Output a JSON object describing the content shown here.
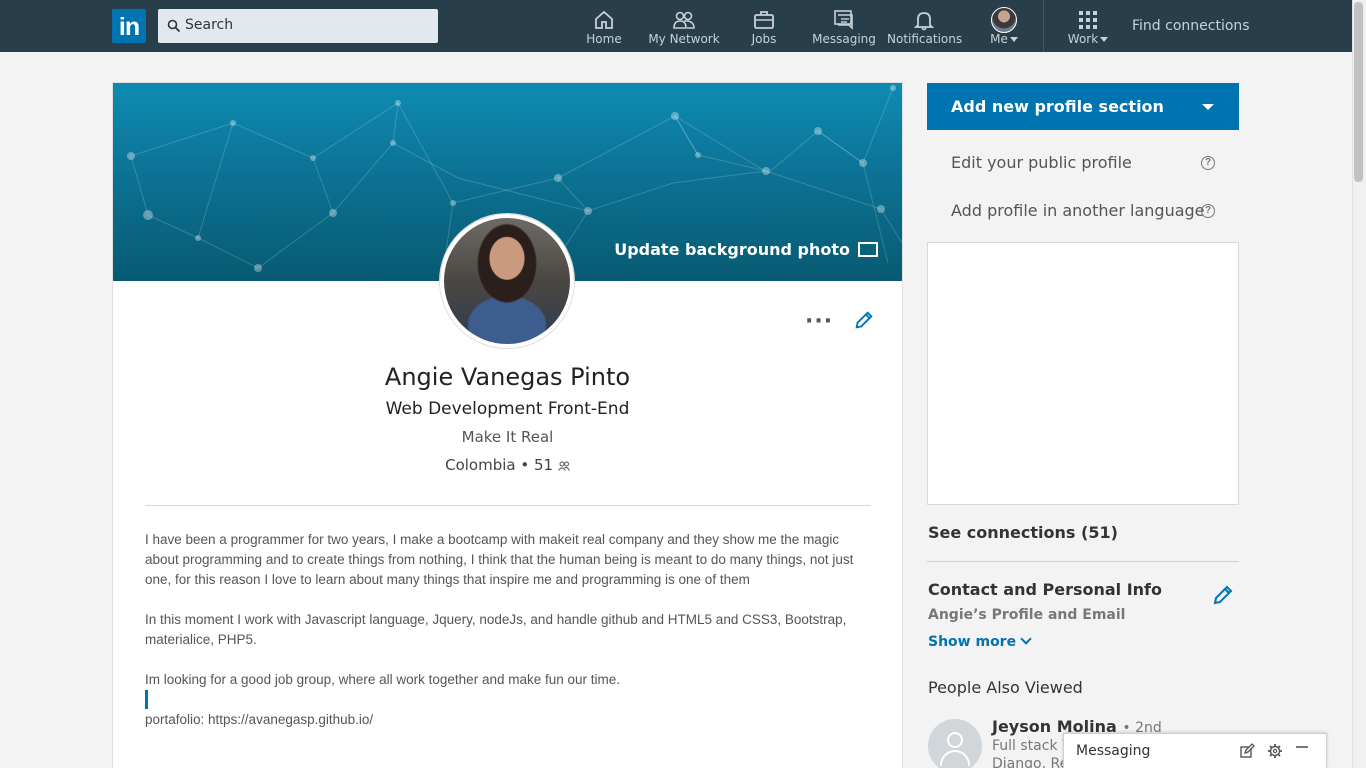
{
  "nav": {
    "logo": "in",
    "search_placeholder": "Search",
    "items": [
      {
        "label": "Home",
        "icon": "home-icon"
      },
      {
        "label": "My Network",
        "icon": "network-icon"
      },
      {
        "label": "Jobs",
        "icon": "briefcase-icon"
      },
      {
        "label": "Messaging",
        "icon": "messaging-icon"
      },
      {
        "label": "Notifications",
        "icon": "bell-icon"
      },
      {
        "label": "Me",
        "icon": "avatar"
      },
      {
        "label": "Work",
        "icon": "grid-icon"
      }
    ],
    "find_connections": "Find connections"
  },
  "profile": {
    "update_background": "Update background photo",
    "more": "···",
    "name": "Angie Vanegas Pinto",
    "headline": "Web Development Front-End",
    "company": "Make It Real",
    "location": "Colombia",
    "connections_count": "51",
    "about": [
      "I have been a programmer for two years, I make a bootcamp with makeit real company and they show me the magic about programming and to create things from nothing, I think that the human being is meant to do many things, not just one, for this reason I love to learn about many things that inspire me and programming is one of them",
      "In this moment I work with Javascript language, Jquery, nodeJs, and handle github and HTML5 and CSS3, Bootstrap, materialice, PHP5.",
      "Im looking for a good job group, where all work together and make fun our time.",
      "portafolio: https://avanegasp.github.io/"
    ]
  },
  "rail": {
    "add_section": "Add new profile section",
    "edit_public": "Edit your public profile",
    "add_language": "Add profile in another language",
    "help_glyph": "?",
    "see_connections": "See connections (51)",
    "contact_title": "Contact and Personal Info",
    "contact_sub": "Angie’s Profile and Email",
    "show_more": "Show more",
    "people_also_viewed": "People Also Viewed",
    "person": {
      "name": "Jeyson Molina",
      "degree": "• 2nd",
      "line1": "Full stack W",
      "line2": "Django, Rea"
    }
  },
  "messaging": {
    "label": "Messaging"
  },
  "colors": {
    "nav_bg": "#283e4a",
    "brand_blue": "#0073b1",
    "page_bg": "#f3f3f3"
  }
}
